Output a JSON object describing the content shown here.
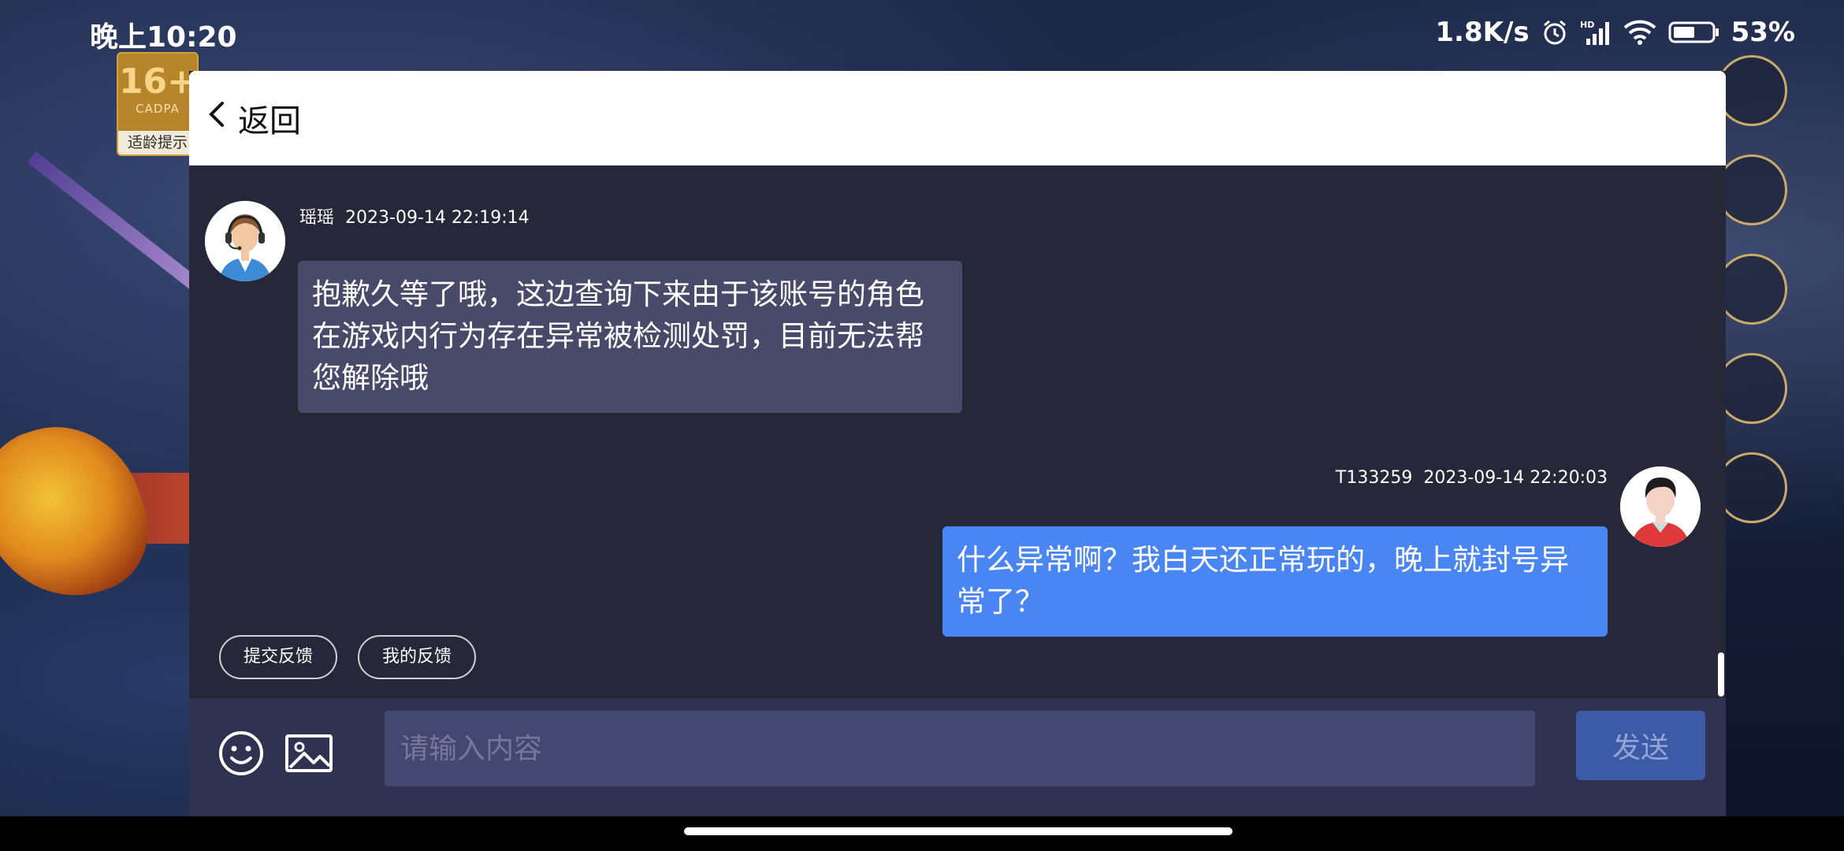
{
  "status_bar": {
    "time": "晚上10:20",
    "network_speed": "1.8K/s",
    "battery": "53%",
    "icons": [
      "alarm-icon",
      "hd-signal-icon",
      "wifi-icon",
      "battery-icon"
    ]
  },
  "age_rating": {
    "age": "16+",
    "org": "CADPA",
    "tip": "适龄提示"
  },
  "header": {
    "back_label": "返回"
  },
  "messages": [
    {
      "sender": "瑶瑶",
      "time": "2023-09-14 22:19:14",
      "text": "抱歉久等了哦，这边查询下来由于该账号的角色在游戏内行为存在异常被检测处罚，目前无法帮您解除哦",
      "side": "left"
    },
    {
      "sender": "T133259",
      "time": "2023-09-14 22:20:03",
      "text": "什么异常啊？我白天还正常玩的，晚上就封号异常了？",
      "side": "right"
    }
  ],
  "quick_actions": [
    "提交反馈",
    "我的反馈"
  ],
  "composer": {
    "placeholder": "请输入内容",
    "send_label": "发送"
  },
  "colors": {
    "dialog_bg": "#262739",
    "agent_bubble": "#494a69",
    "user_bubble": "#4a86f3",
    "composer_bg": "#313251",
    "send_button": "#3c5aa6"
  }
}
